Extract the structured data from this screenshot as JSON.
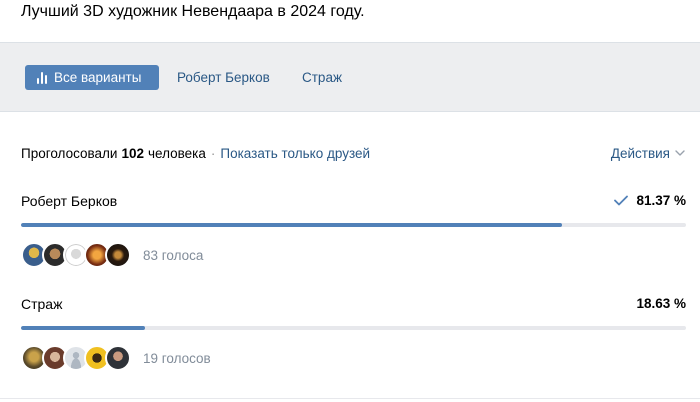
{
  "poll": {
    "title": "Лучший 3D художник Невендаара в 2024 году."
  },
  "tabs": {
    "all": "Все варианты",
    "items": [
      "Роберт Берков",
      "Страж"
    ]
  },
  "stats": {
    "voted_label": "Проголосовали",
    "voted_count": "102",
    "voted_suffix": "человека",
    "dot": "·",
    "friends_link": "Показать только друзей",
    "actions_label": "Действия"
  },
  "options": [
    {
      "label": "Роберт Берков",
      "percent_text": "81.37 %",
      "percent_value": 81.37,
      "votes_text": "83 голоса",
      "voted_by_me": true
    },
    {
      "label": "Страж",
      "percent_text": "18.63 %",
      "percent_value": 18.63,
      "votes_text": "19 голосов",
      "voted_by_me": false
    }
  ],
  "colors": {
    "accent": "#5181b8",
    "link": "#2a5885",
    "muted": "#818c99",
    "track": "#e7e8ec",
    "tabs_bg": "#edeef0"
  },
  "icons": {
    "tab_all": "bar-chart-icon",
    "actions": "chevron-down-icon",
    "voted": "checkmark-icon"
  }
}
